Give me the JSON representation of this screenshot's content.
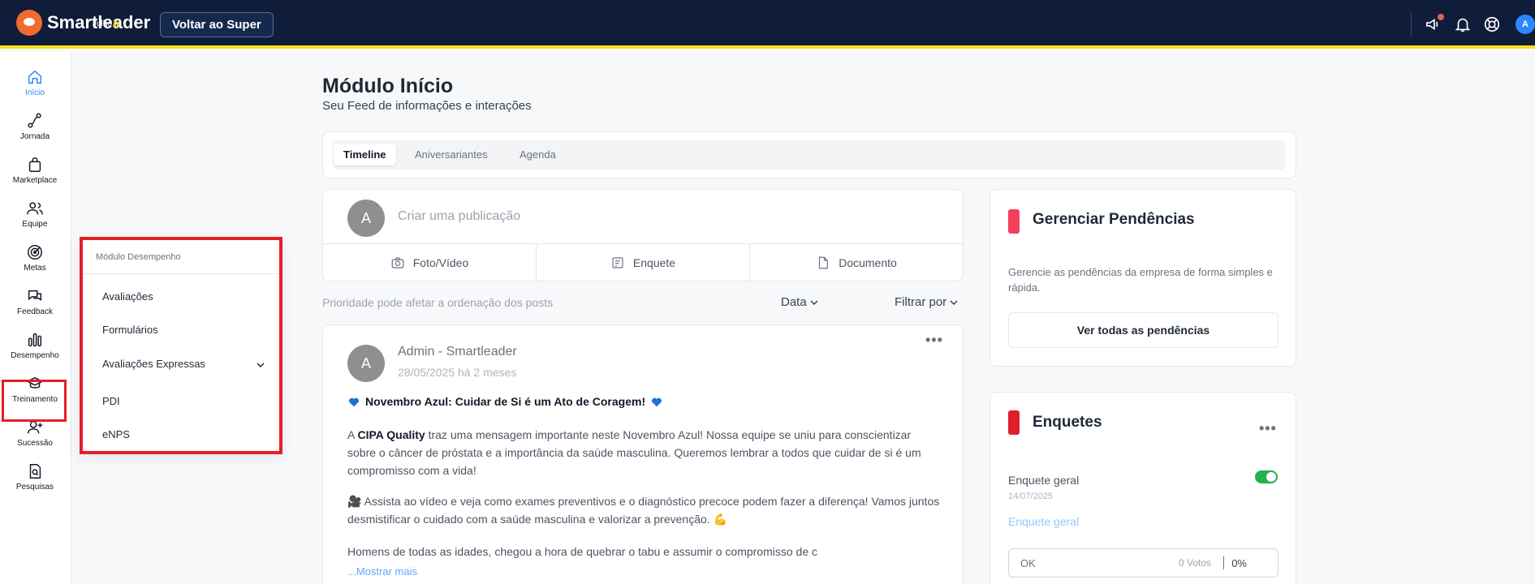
{
  "header": {
    "brand": "Smartleader",
    "brand_sub": "Julho",
    "back_button": "Voltar ao Super",
    "user_initial": "A",
    "icons": [
      "megaphone-icon",
      "bell-icon",
      "lifebuoy-icon"
    ]
  },
  "sidebar": {
    "items": [
      {
        "label": "Início",
        "icon": "home-icon",
        "active": true
      },
      {
        "label": "Jornada",
        "icon": "journey-icon"
      },
      {
        "label": "Marketplace",
        "icon": "shopping-bag-icon"
      },
      {
        "label": "Equipe",
        "icon": "team-icon"
      },
      {
        "label": "Metas",
        "icon": "target-icon"
      },
      {
        "label": "Feedback",
        "icon": "chat-icon"
      },
      {
        "label": "Desempenho",
        "icon": "bar-chart-icon"
      },
      {
        "label": "Treinamento",
        "icon": "graduation-cap-icon"
      },
      {
        "label": "Sucessão",
        "icon": "user-plus-icon"
      },
      {
        "label": "Pesquisas",
        "icon": "search-document-icon"
      }
    ]
  },
  "flyout": {
    "title": "Módulo Desempenho",
    "items": [
      "Avaliações",
      "Formulários",
      "Avaliações Expressas",
      "PDI",
      "eNPS"
    ]
  },
  "page": {
    "title": "Módulo Início",
    "subtitle": "Seu Feed de informações e interações",
    "tabs": [
      "Timeline",
      "Aniversariantes",
      "Agenda"
    ]
  },
  "composer": {
    "avatar": "A",
    "placeholder": "Criar uma publicação",
    "actions": [
      "Foto/Vídeo",
      "Enquete",
      "Documento"
    ]
  },
  "feed": {
    "priority_note": "Prioridade pode afetar a ordenação dos posts",
    "sort_label": "Data",
    "filter_label": "Filtrar por"
  },
  "post": {
    "avatar": "A",
    "author": "Admin - Smartleader",
    "date": "28/05/2025 há 2 meses",
    "heading": "Novembro Azul: Cuidar de Si é um Ato de Coragem!",
    "p1_prefix": "A ",
    "p1_bold": "CIPA Quality",
    "p1_rest": " traz uma mensagem importante neste Novembro Azul! Nossa equipe se uniu para conscientizar sobre o câncer de próstata e a importância da saúde masculina. Queremos lembrar a todos que cuidar de si é um compromisso com a vida!",
    "p2": "🎥 Assista ao vídeo e veja como exames preventivos e o diagnóstico precoce podem fazer a diferença! Vamos juntos desmistificar o cuidado com a saúde masculina e valorizar a prevenção. 💪",
    "p3": "Homens de todas as idades, chegou a hora de quebrar o tabu e assumir o compromisso de c",
    "show_more": "...Mostrar mais"
  },
  "pendencias": {
    "title": "Gerenciar Pendências",
    "description": "Gerencie as pendências da empresa de forma simples e rápida.",
    "button": "Ver todas as pendências",
    "accent": "#f43f5e"
  },
  "enquetes": {
    "title": "Enquetes",
    "accent": "#e11d2a",
    "poll_name": "Enquete geral",
    "poll_date": "14/07/2025",
    "poll_link": "Enquete geral",
    "option_label": "OK",
    "option_votes": "0 Votos",
    "option_pct": "0%"
  }
}
